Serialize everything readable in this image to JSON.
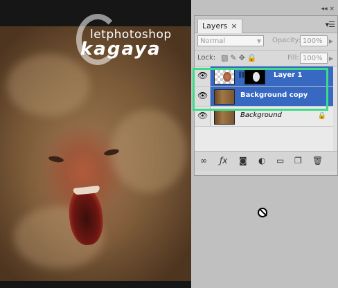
{
  "watermark": {
    "top_text": "letphotoshop",
    "main_text": "kagaya"
  },
  "layers_panel": {
    "tab_label": "Layers",
    "tab_close": "×",
    "menu_icon": "panel-menu-icon",
    "blend_mode": "Normal",
    "opacity_label": "Opacity:",
    "opacity_value": "100%",
    "lock_label": "Lock:",
    "fill_label": "Fill:",
    "fill_value": "100%",
    "layers": [
      {
        "name": "Layer 1",
        "selected": true,
        "has_mask": true
      },
      {
        "name": "Background copy",
        "selected": true,
        "has_mask": false
      },
      {
        "name": "Background",
        "selected": false,
        "locked": true
      }
    ],
    "highlight_color": "#3ddc8a",
    "selection_color": "#3768c2"
  },
  "bottom_icons": [
    "link-icon",
    "fx-icon",
    "mask-icon",
    "adjustment-icon",
    "folder-icon",
    "new-layer-icon",
    "trash-icon"
  ]
}
